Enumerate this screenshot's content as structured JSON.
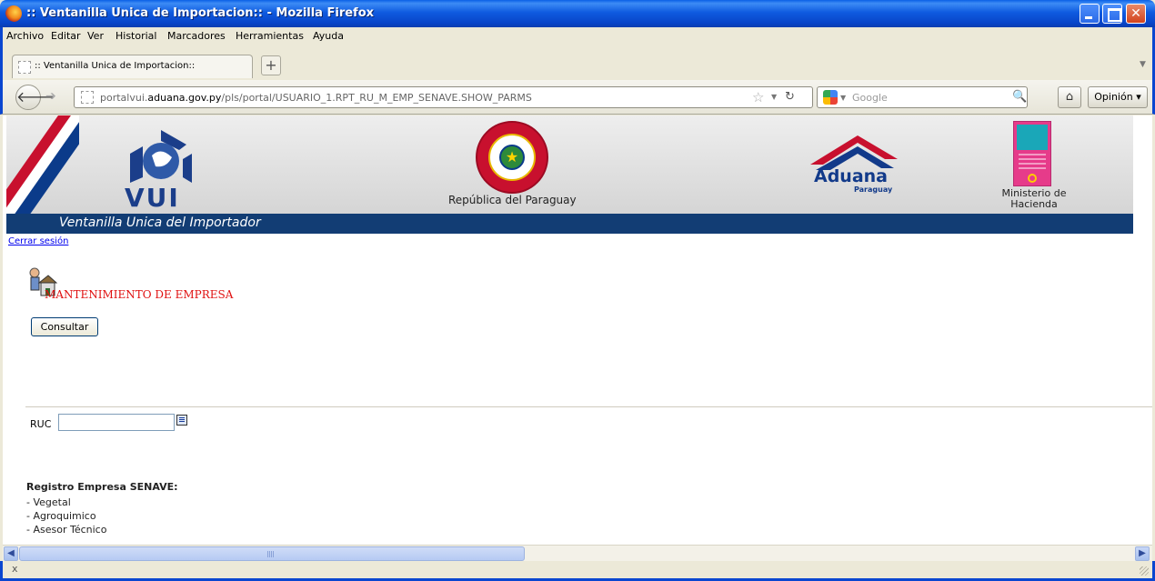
{
  "window": {
    "title": ":: Ventanilla Unica de Importacion:: - Mozilla Firefox"
  },
  "menu": [
    "Archivo",
    "Editar",
    "Ver",
    "Historial",
    "Marcadores",
    "Herramientas",
    "Ayuda"
  ],
  "tab": {
    "label": ":: Ventanilla Unica de Importacion::"
  },
  "nav": {
    "url_prefix": "portalvui.",
    "url_domain": "aduana.gov.py",
    "url_path": "/pls/portal/USUARIO_1.RPT_RU_M_EMP_SENAVE.SHOW_PARMS",
    "search_placeholder": "Google",
    "opinion_label": "Opinión"
  },
  "banner": {
    "vui_text": "VUI",
    "paraguay_caption": "República del Paraguay",
    "aduana_name": "Aduana",
    "aduana_sub": "Paraguay",
    "ministerio_caption": "Ministerio de Hacienda",
    "tagline": "Ventanilla Unica del Importador"
  },
  "page": {
    "logout_link": "Cerrar sesión",
    "section_title": "MANTENIMIENTO DE EMPRESA",
    "consult_button": "Consultar",
    "ruc_label": "RUC",
    "ruc_value": "",
    "registro_title": "Registro Empresa SENAVE:",
    "registro_items": [
      "- Vegetal",
      "- Agroquimico",
      "- Asesor Técnico"
    ]
  },
  "status": {
    "text": "x"
  }
}
